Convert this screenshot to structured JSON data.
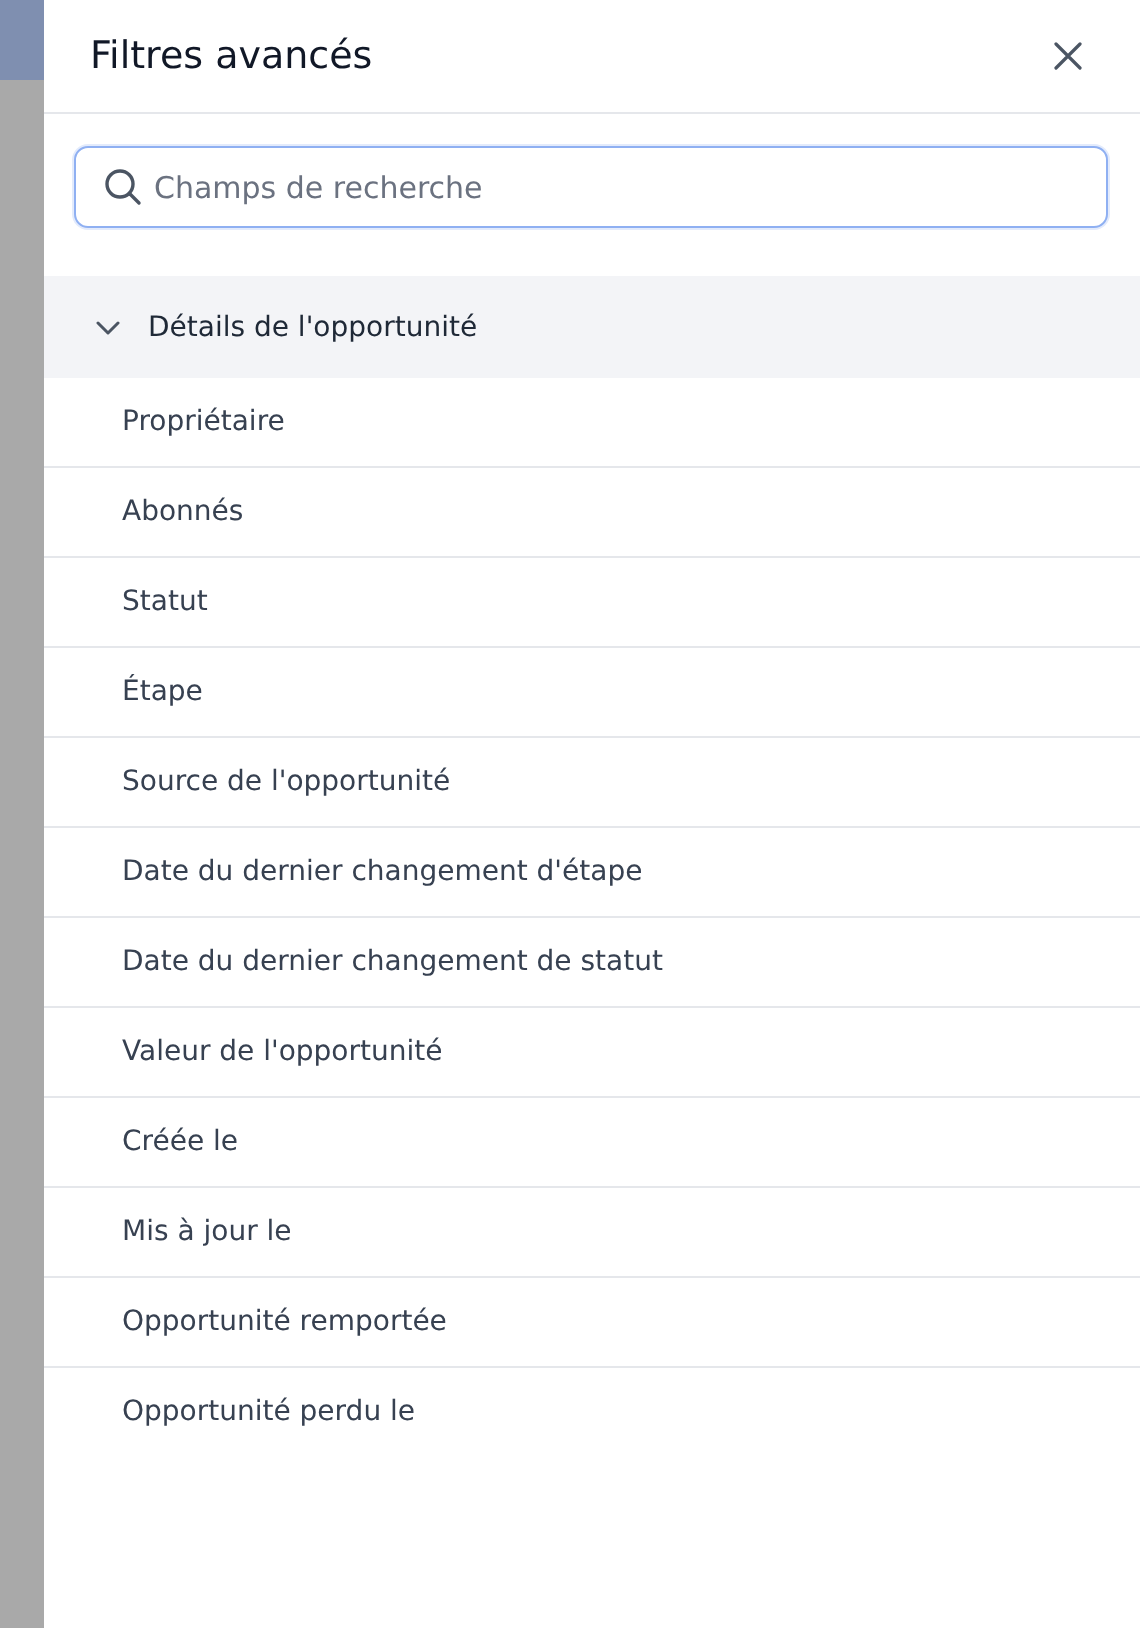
{
  "panel": {
    "title": "Filtres avancés",
    "search": {
      "placeholder": "Champs de recherche"
    },
    "sections": [
      {
        "label": "Détails de l'opportunité",
        "expanded": true,
        "items": [
          "Propriétaire",
          "Abonnés",
          "Statut",
          "Étape",
          "Source de l'opportunité",
          "Date du dernier changement d'étape",
          "Date du dernier changement de statut",
          "Valeur de l'opportunité",
          "Créée le",
          "Mis à jour le",
          "Opportunité remportée",
          "Opportunité perdu le"
        ]
      }
    ]
  }
}
